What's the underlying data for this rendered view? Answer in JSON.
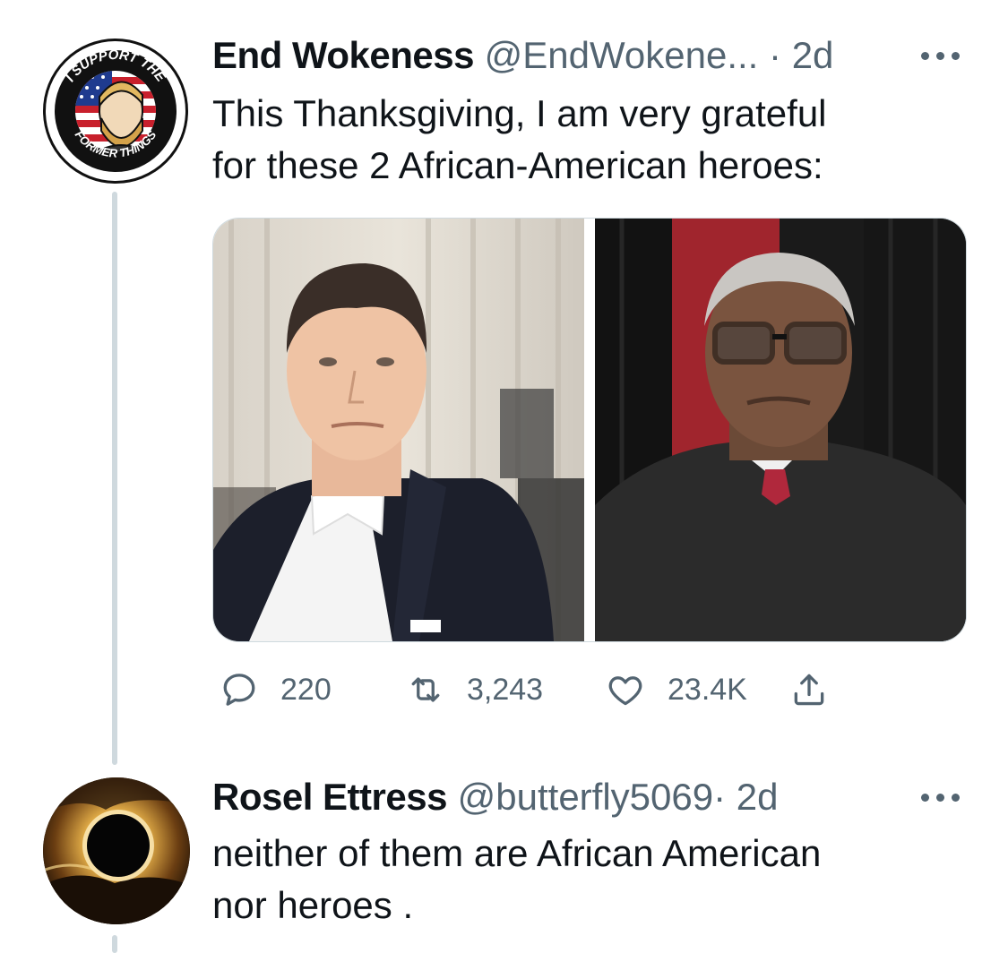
{
  "tweet": {
    "display_name": "End Wokeness",
    "handle": "@EndWokene...",
    "separator": "·",
    "time": "2d",
    "text_line1": "This Thanksgiving, I am very grateful",
    "text_line2": "for these 2 African-American heroes:",
    "avatar": {
      "icon": "i-support-the-former-things-badge",
      "arc_top": "I SUPPORT THE",
      "arc_bottom": "FORMER THINGS"
    },
    "media": [
      {
        "icon": "man-in-tuxedo-photo"
      },
      {
        "icon": "man-in-judicial-robe-photo"
      }
    ],
    "actions": {
      "reply_count": "220",
      "retweet_count": "3,243",
      "like_count": "23.4K"
    }
  },
  "reply": {
    "display_name": "Rosel Ettress",
    "handle": "@butterfly5069",
    "separator": "·",
    "time": "2d",
    "text_line1": "neither of them are African American",
    "text_line2": "nor heroes .",
    "avatar": {
      "icon": "solar-eclipse-avatar"
    }
  },
  "colors": {
    "secondary_text": "#536471",
    "primary_text": "#0f1419",
    "thread_line": "#cfd9de"
  }
}
